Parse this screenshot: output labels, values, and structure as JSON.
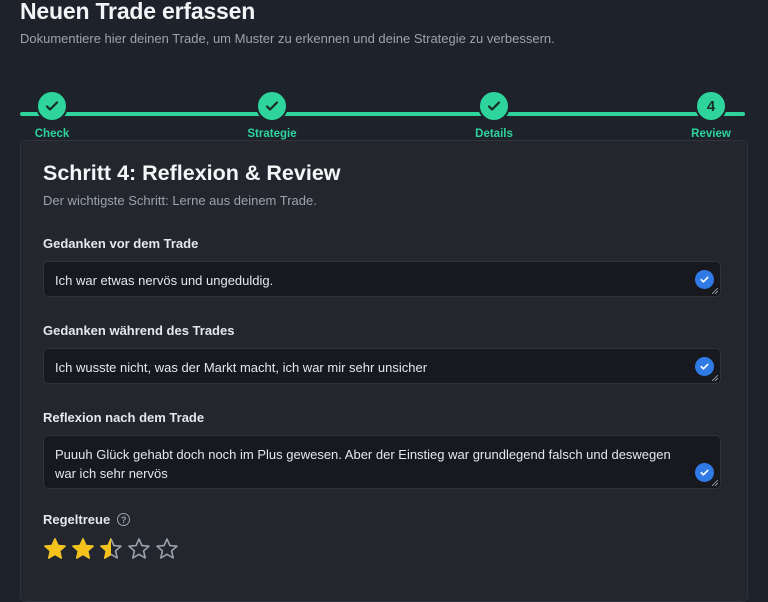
{
  "header": {
    "title": "Neuen Trade erfassen",
    "subtitle": "Dokumentiere hier deinen Trade, um Muster zu erkennen und deine Strategie zu verbessern."
  },
  "stepper": {
    "steps": [
      {
        "label": "Check",
        "state": "done"
      },
      {
        "label": "Strategie",
        "state": "done"
      },
      {
        "label": "Details",
        "state": "done"
      },
      {
        "label": "Review",
        "state": "current",
        "number": "4"
      }
    ]
  },
  "card": {
    "title": "Schritt 4: Reflexion & Review",
    "subtitle": "Der wichtigste Schritt: Lerne aus deinem Trade.",
    "fields": [
      {
        "label": "Gedanken vor dem Trade",
        "value": "Ich war etwas nervös und ungeduldig."
      },
      {
        "label": "Gedanken während des Trades",
        "value": "Ich wusste nicht, was der Markt macht, ich war mir sehr unsicher"
      },
      {
        "label": "Reflexion nach dem Trade",
        "value": "Puuuh Glück gehabt doch noch im Plus gewesen. Aber der Einstieg war grundlegend falsch und deswegen war ich sehr nervös"
      }
    ],
    "rating": {
      "label": "Regeltreue",
      "value": 2.5,
      "max": 5
    }
  },
  "colors": {
    "accent": "#2ed49b",
    "check_badge": "#2f7ae5",
    "star_filled": "#f4c21b",
    "star_empty": "#9aa3af"
  },
  "icons": {
    "step_done": "check-icon",
    "field_valid": "check-circle-icon",
    "help": "question-circle-icon",
    "rating": "star-icon"
  }
}
